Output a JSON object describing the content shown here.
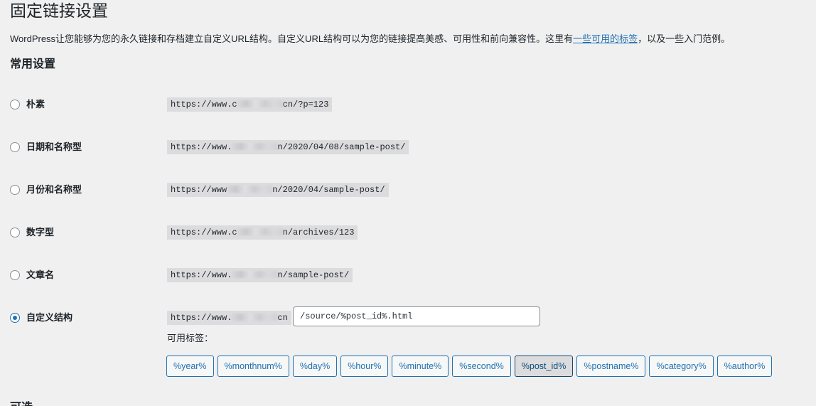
{
  "page": {
    "title": "固定链接设置",
    "intro_before": "WordPress让您能够为您的永久链接和存档建立自定义URL结构。自定义URL结构可以为您的链接提高美感、可用性和前向兼容性。这里有",
    "intro_link": "一些可用的标签",
    "intro_after": "，以及一些入门范例。",
    "section_title": "常用设置"
  },
  "options": [
    {
      "label": "朴素",
      "prefix": "https://www.c",
      "suffix": "cn/?p=123",
      "checked": false
    },
    {
      "label": "日期和名称型",
      "prefix": "https://www.",
      "suffix": "n/2020/04/08/sample-post/",
      "checked": false
    },
    {
      "label": "月份和名称型",
      "prefix": "https://www",
      "suffix": "n/2020/04/sample-post/",
      "checked": false
    },
    {
      "label": "数字型",
      "prefix": "https://www.c",
      "suffix": "n/archives/123",
      "checked": false
    },
    {
      "label": "文章名",
      "prefix": "https://www.",
      "suffix": "n/sample-post/",
      "checked": false
    },
    {
      "label": "自定义结构",
      "prefix": "https://www.",
      "suffix": "cn",
      "checked": true
    }
  ],
  "custom_structure": {
    "value": "/source/%post_id%.html"
  },
  "available_tags": {
    "label": "可用标签：",
    "tags": [
      "%year%",
      "%monthnum%",
      "%day%",
      "%hour%",
      "%minute%",
      "%second%",
      "%post_id%",
      "%postname%",
      "%category%",
      "%author%"
    ],
    "active_tag": "%post_id%"
  },
  "next_section_partial": "可选"
}
